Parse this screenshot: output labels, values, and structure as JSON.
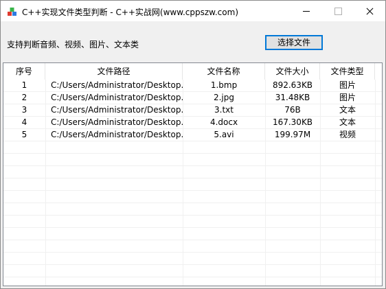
{
  "window": {
    "title": "C++实现文件类型判断  - C++实战网(www.cppszw.com)",
    "app_icon": "app-cubes-icon"
  },
  "toolbar": {
    "support_label": "支持判断音频、视频、图片、文本类",
    "select_button": "选择文件"
  },
  "table": {
    "columns": [
      "序号",
      "文件路径",
      "文件名称",
      "文件大小",
      "文件类型"
    ],
    "rows": [
      {
        "index": "1",
        "path": "C:/Users/Administrator/Desktop...",
        "name": "1.bmp",
        "size": "892.63KB",
        "type": "图片"
      },
      {
        "index": "2",
        "path": "C:/Users/Administrator/Desktop...",
        "name": "2.jpg",
        "size": "31.48KB",
        "type": "图片"
      },
      {
        "index": "3",
        "path": "C:/Users/Administrator/Desktop...",
        "name": "3.txt",
        "size": "76B",
        "type": "文本"
      },
      {
        "index": "4",
        "path": "C:/Users/Administrator/Desktop...",
        "name": "4.docx",
        "size": "167.30KB",
        "type": "文本"
      },
      {
        "index": "5",
        "path": "C:/Users/Administrator/Desktop...",
        "name": "5.avi",
        "size": "199.97M",
        "type": "视频"
      }
    ]
  },
  "colors": {
    "button_border": "#0078d7",
    "window_bg": "#f0f0f0"
  }
}
